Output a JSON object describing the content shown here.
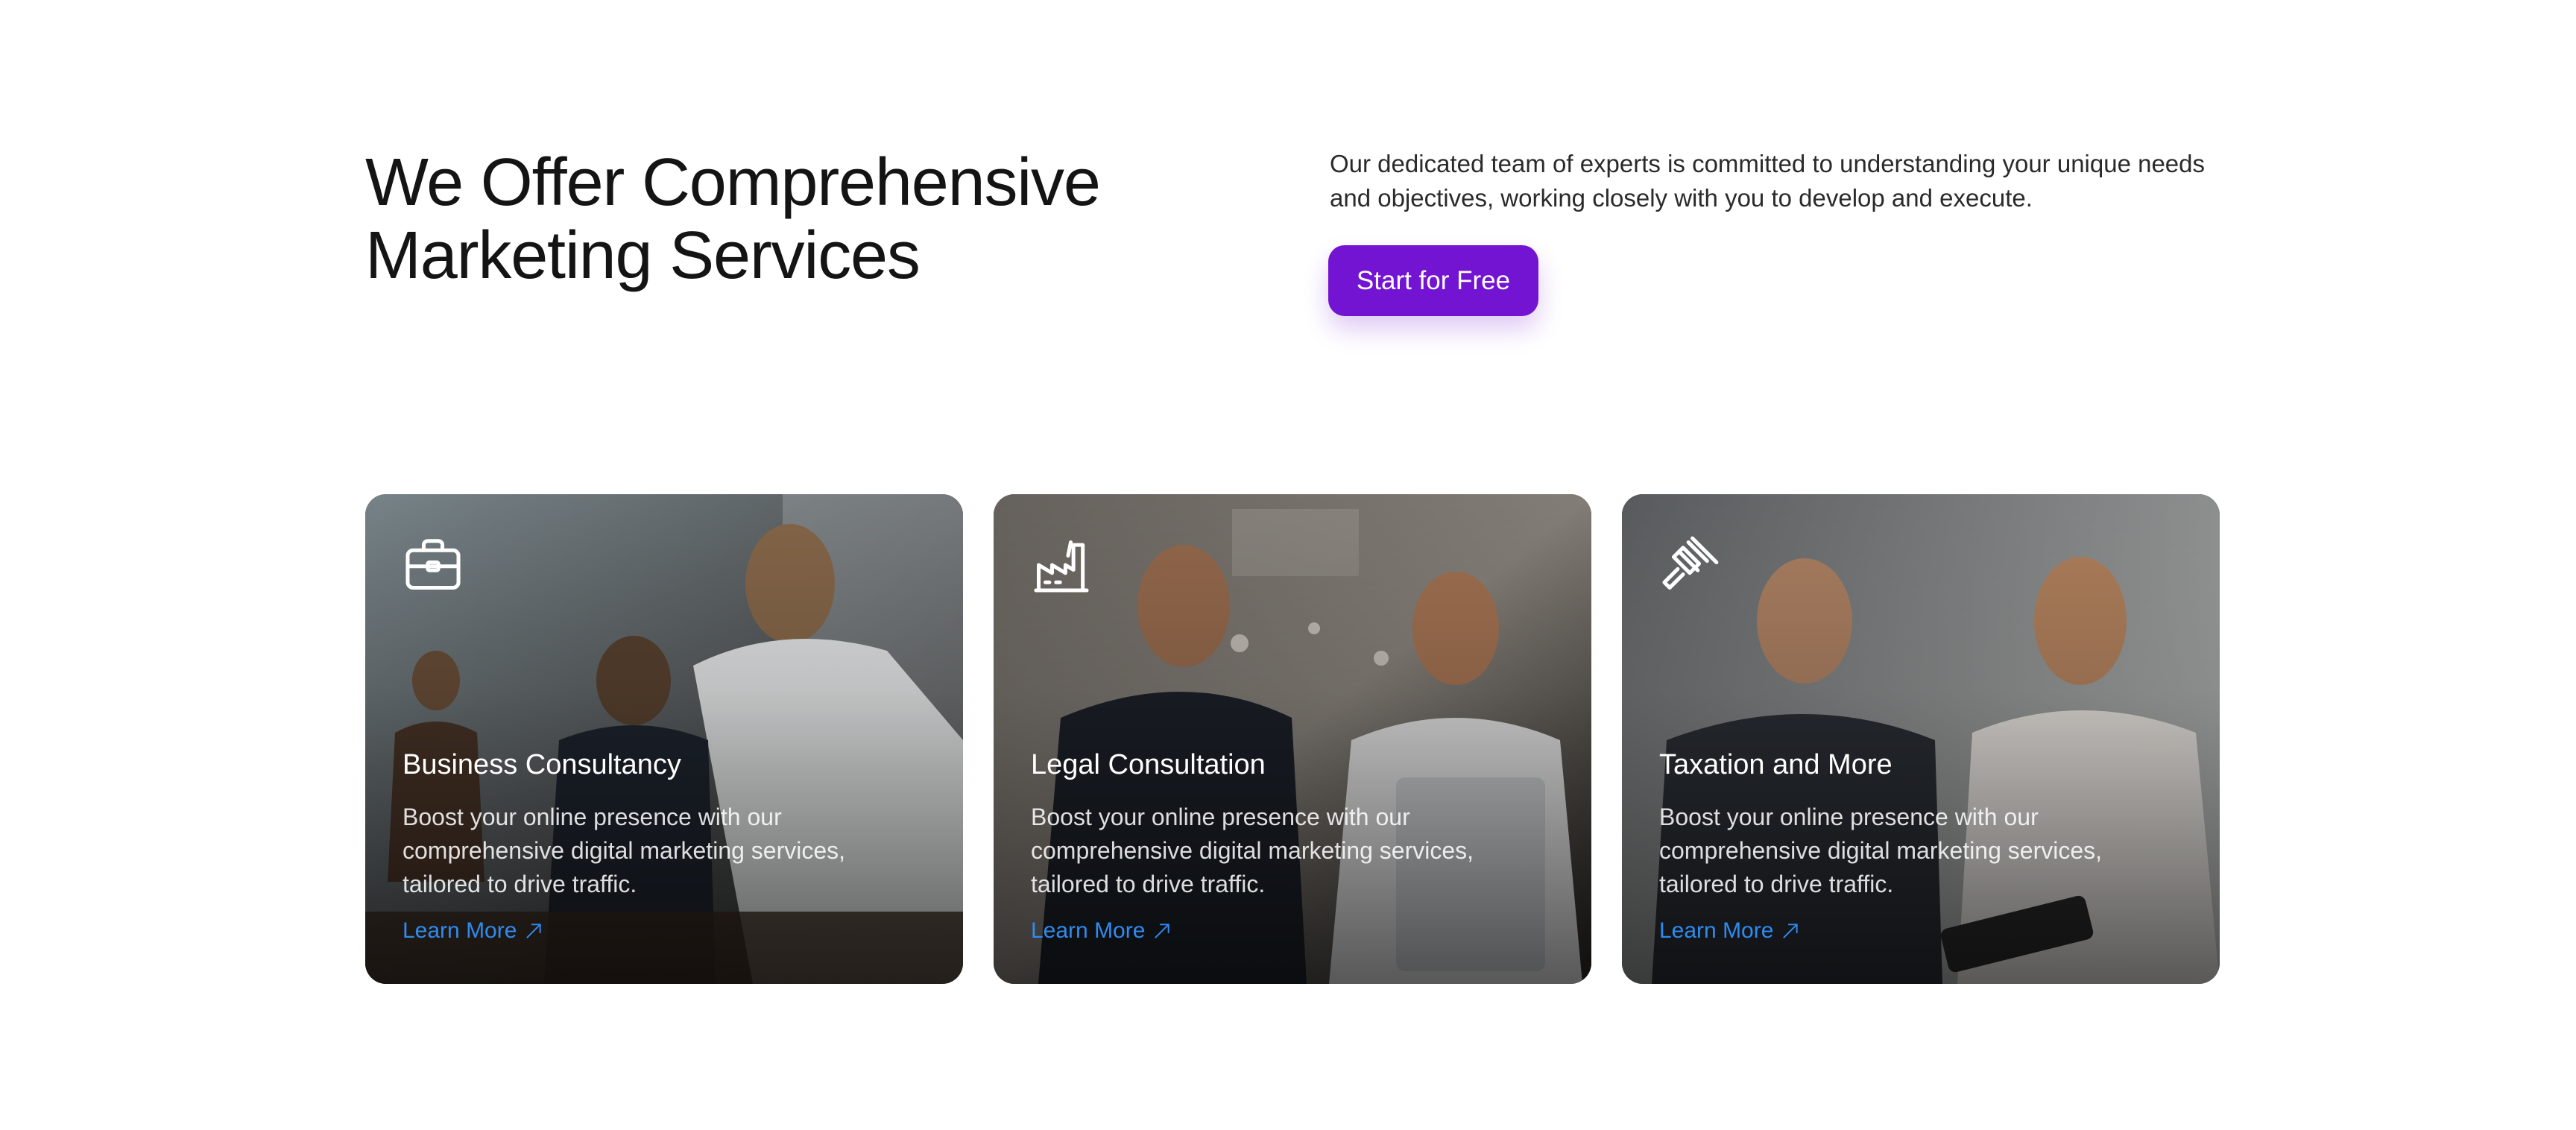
{
  "heading": {
    "line1": "We Offer Comprehensive",
    "line2": "Marketing Services"
  },
  "intro": {
    "text": "Our dedicated team of experts is committed to understanding your unique needs and objectives, working closely with you to develop and execute."
  },
  "cta": {
    "label": "Start for Free",
    "color": "#7314d3"
  },
  "cards": [
    {
      "icon": "briefcase-icon",
      "title": "Business Consultancy",
      "description": "Boost your online presence with our comprehensive digital marketing services, tailored to drive traffic.",
      "link": "Learn More"
    },
    {
      "icon": "factory-icon",
      "title": "Legal Consultation",
      "description": "Boost your online presence with our comprehensive digital marketing services, tailored to drive traffic.",
      "link": "Learn More"
    },
    {
      "icon": "gavel-icon",
      "title": "Taxation and More",
      "description": "Boost your online presence with our comprehensive digital marketing services, tailored to drive traffic.",
      "link": "Learn More"
    }
  ],
  "colors": {
    "link": "#2f8bf0",
    "heading": "#141414"
  }
}
